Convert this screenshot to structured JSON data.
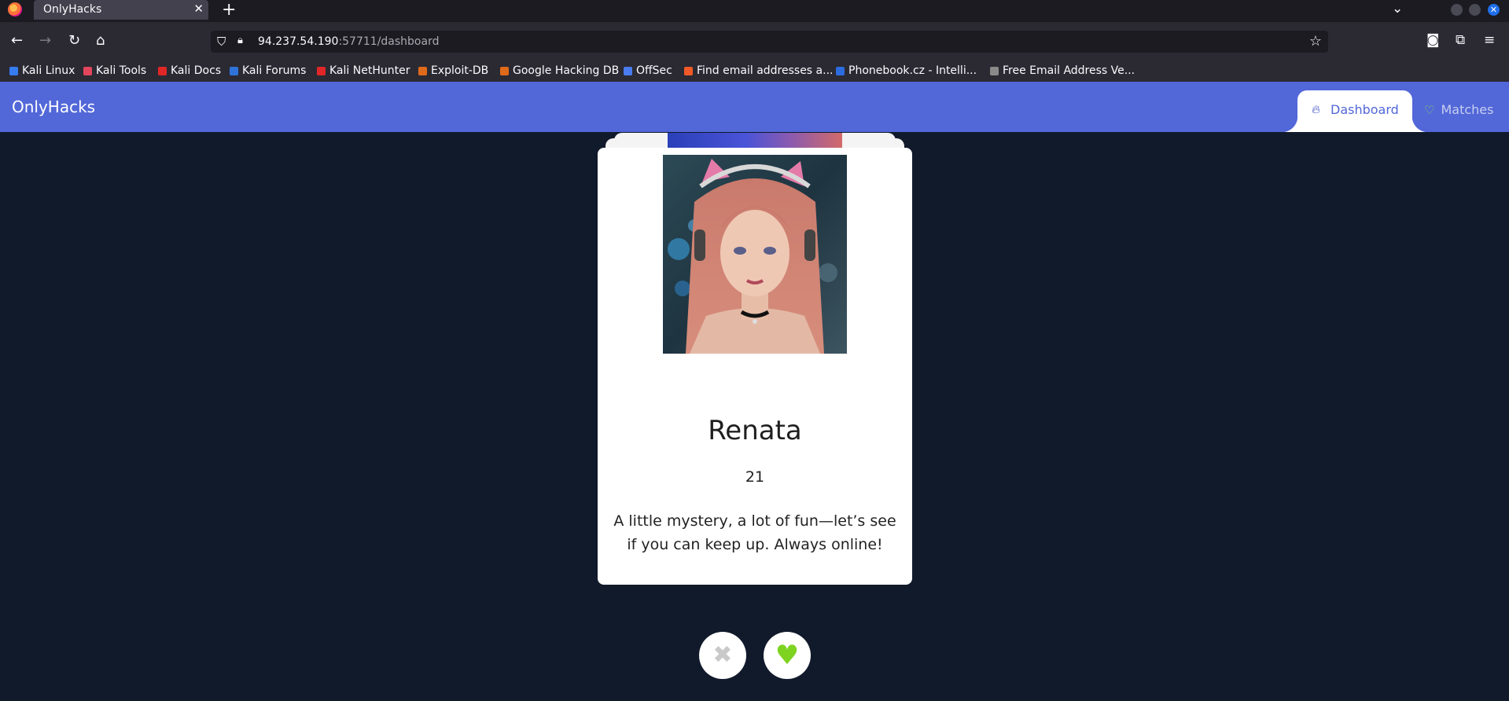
{
  "browser": {
    "tab_title": "OnlyHacks",
    "url_host": "94.237.54.190",
    "url_path": ":57711/dashboard",
    "bookmarks": [
      {
        "label": "Kali Linux",
        "color": "#367bf0"
      },
      {
        "label": "Kali Tools",
        "color": "#e2465d"
      },
      {
        "label": "Kali Docs",
        "color": "#e02626"
      },
      {
        "label": "Kali Forums",
        "color": "#2f73d9"
      },
      {
        "label": "Kali NetHunter",
        "color": "#e02626"
      },
      {
        "label": "Exploit-DB",
        "color": "#e06a1b"
      },
      {
        "label": "Google Hacking DB",
        "color": "#e06a1b"
      },
      {
        "label": "OffSec",
        "color": "#4a7cf0"
      },
      {
        "label": "Find email addresses a...",
        "color": "#f05a28"
      },
      {
        "label": "Phonebook.cz - Intelli...",
        "color": "#2d6cdf"
      },
      {
        "label": "Free Email Address Ve...",
        "color": "#8a8a8a"
      }
    ]
  },
  "app": {
    "brand": "OnlyHacks",
    "nav": {
      "dashboard": "Dashboard",
      "matches": "Matches"
    }
  },
  "profile": {
    "name": "Renata",
    "age": "21",
    "bio": "A little mystery, a lot of fun—let’s see if you can keep up. Always online!"
  },
  "colors": {
    "nav_bg": "#5267d8",
    "page_bg": "#111a2b",
    "like": "#7ed321"
  }
}
